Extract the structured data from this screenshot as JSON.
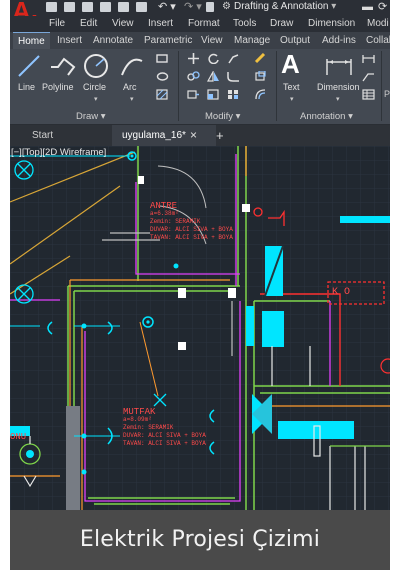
{
  "app": {
    "logo_letter": "A",
    "workspace": "Drafting & Annotation"
  },
  "menu": [
    "File",
    "Edit",
    "View",
    "Insert",
    "Format",
    "Tools",
    "Draw",
    "Dimension",
    "Modi"
  ],
  "ribbon_tabs": [
    "Home",
    "Insert",
    "Annotate",
    "Parametric",
    "View",
    "Manage",
    "Output",
    "Add-ins",
    "Collab"
  ],
  "ribbon": {
    "tools": [
      "Line",
      "Polyline",
      "Circle",
      "Arc",
      "Text",
      "Dimension"
    ],
    "panels": [
      "Draw",
      "Modify",
      "Annotation"
    ]
  },
  "file_tabs": {
    "start": "Start",
    "current": "uygulama_16*",
    "close": "×",
    "add": "+"
  },
  "viewport_label": "[−][Top][2D Wireframe]",
  "rooms": {
    "antre": {
      "name": "ANTRE",
      "area": "a=6.38m²",
      "floor": "Zemin: SERAMIK",
      "wall": "DUVAR: ALCI SIVA + BOYA",
      "ceiling": "TAVAN: ALCI SIVA + BOYA"
    },
    "mutfak": {
      "name": "MUTFAK",
      "area": "a=8.09m²",
      "floor": "Zemin: SERAMIK",
      "wall": "DUVAR: ALCI SIVA + BOYA",
      "ceiling": "TAVAN: ALCI SIVA + BOYA"
    }
  },
  "labels": {
    "ko": "K O",
    "onu": "ONU"
  },
  "caption": "Elektrik Projesi Çizimi",
  "colors": {
    "brand_red": "#d9261c",
    "cyan": "#00e5ff",
    "magenta": "#e040fb",
    "green": "#7fd64a",
    "orange": "#ff9a2e",
    "red": "#ff3030"
  }
}
